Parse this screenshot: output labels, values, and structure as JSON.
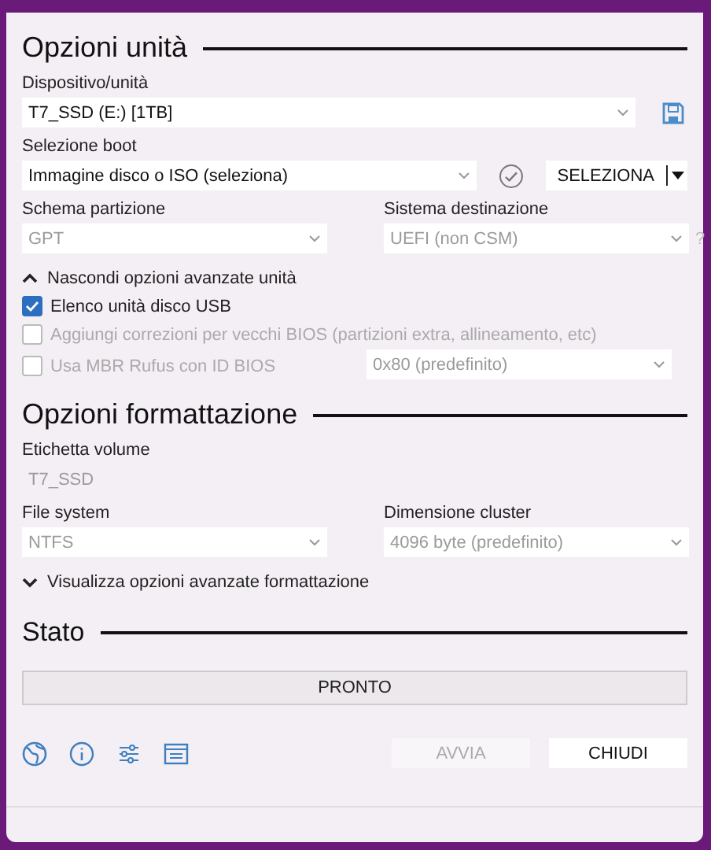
{
  "drive_options": {
    "title": "Opzioni unità",
    "device": {
      "label": "Dispositivo/unità",
      "value": "T7_SSD (E:) [1TB]",
      "disabled": false
    },
    "boot_selection": {
      "label": "Selezione boot",
      "value": "Immagine disco o ISO (seleziona)",
      "disabled": false
    },
    "select_button": "SELEZIONA",
    "partition_scheme": {
      "label": "Schema partizione",
      "value": "GPT",
      "disabled": true
    },
    "target_system": {
      "label": "Sistema destinazione",
      "value": "UEFI (non CSM)",
      "disabled": true
    },
    "help": "?",
    "advanced_toggle": {
      "label": "Nascondi opzioni avanzate unità",
      "expanded": true
    },
    "checkboxes": [
      {
        "label": "Elenco unità disco USB",
        "checked": true,
        "disabled": false
      },
      {
        "label": "Aggiungi correzioni per vecchi BIOS (partizioni extra, allineamento, etc)",
        "checked": false,
        "disabled": true
      },
      {
        "label": "Usa MBR Rufus con ID BIOS",
        "checked": false,
        "disabled": true
      }
    ],
    "bios_id": {
      "value": "0x80 (predefinito)",
      "disabled": true
    }
  },
  "format_options": {
    "title": "Opzioni formattazione",
    "volume_label": {
      "label": "Etichetta volume",
      "value": "T7_SSD",
      "disabled": true
    },
    "file_system": {
      "label": "File system",
      "value": "NTFS",
      "disabled": true
    },
    "cluster_size": {
      "label": "Dimensione cluster",
      "value": "4096 byte (predefinito)",
      "disabled": true
    },
    "advanced_toggle": {
      "label": "Visualizza opzioni avanzate formattazione",
      "expanded": false
    }
  },
  "status": {
    "title": "Stato",
    "progress_text": "PRONTO"
  },
  "buttons": [
    {
      "label": "AVVIA",
      "disabled": true
    },
    {
      "label": "CHIUDI",
      "disabled": false
    }
  ]
}
